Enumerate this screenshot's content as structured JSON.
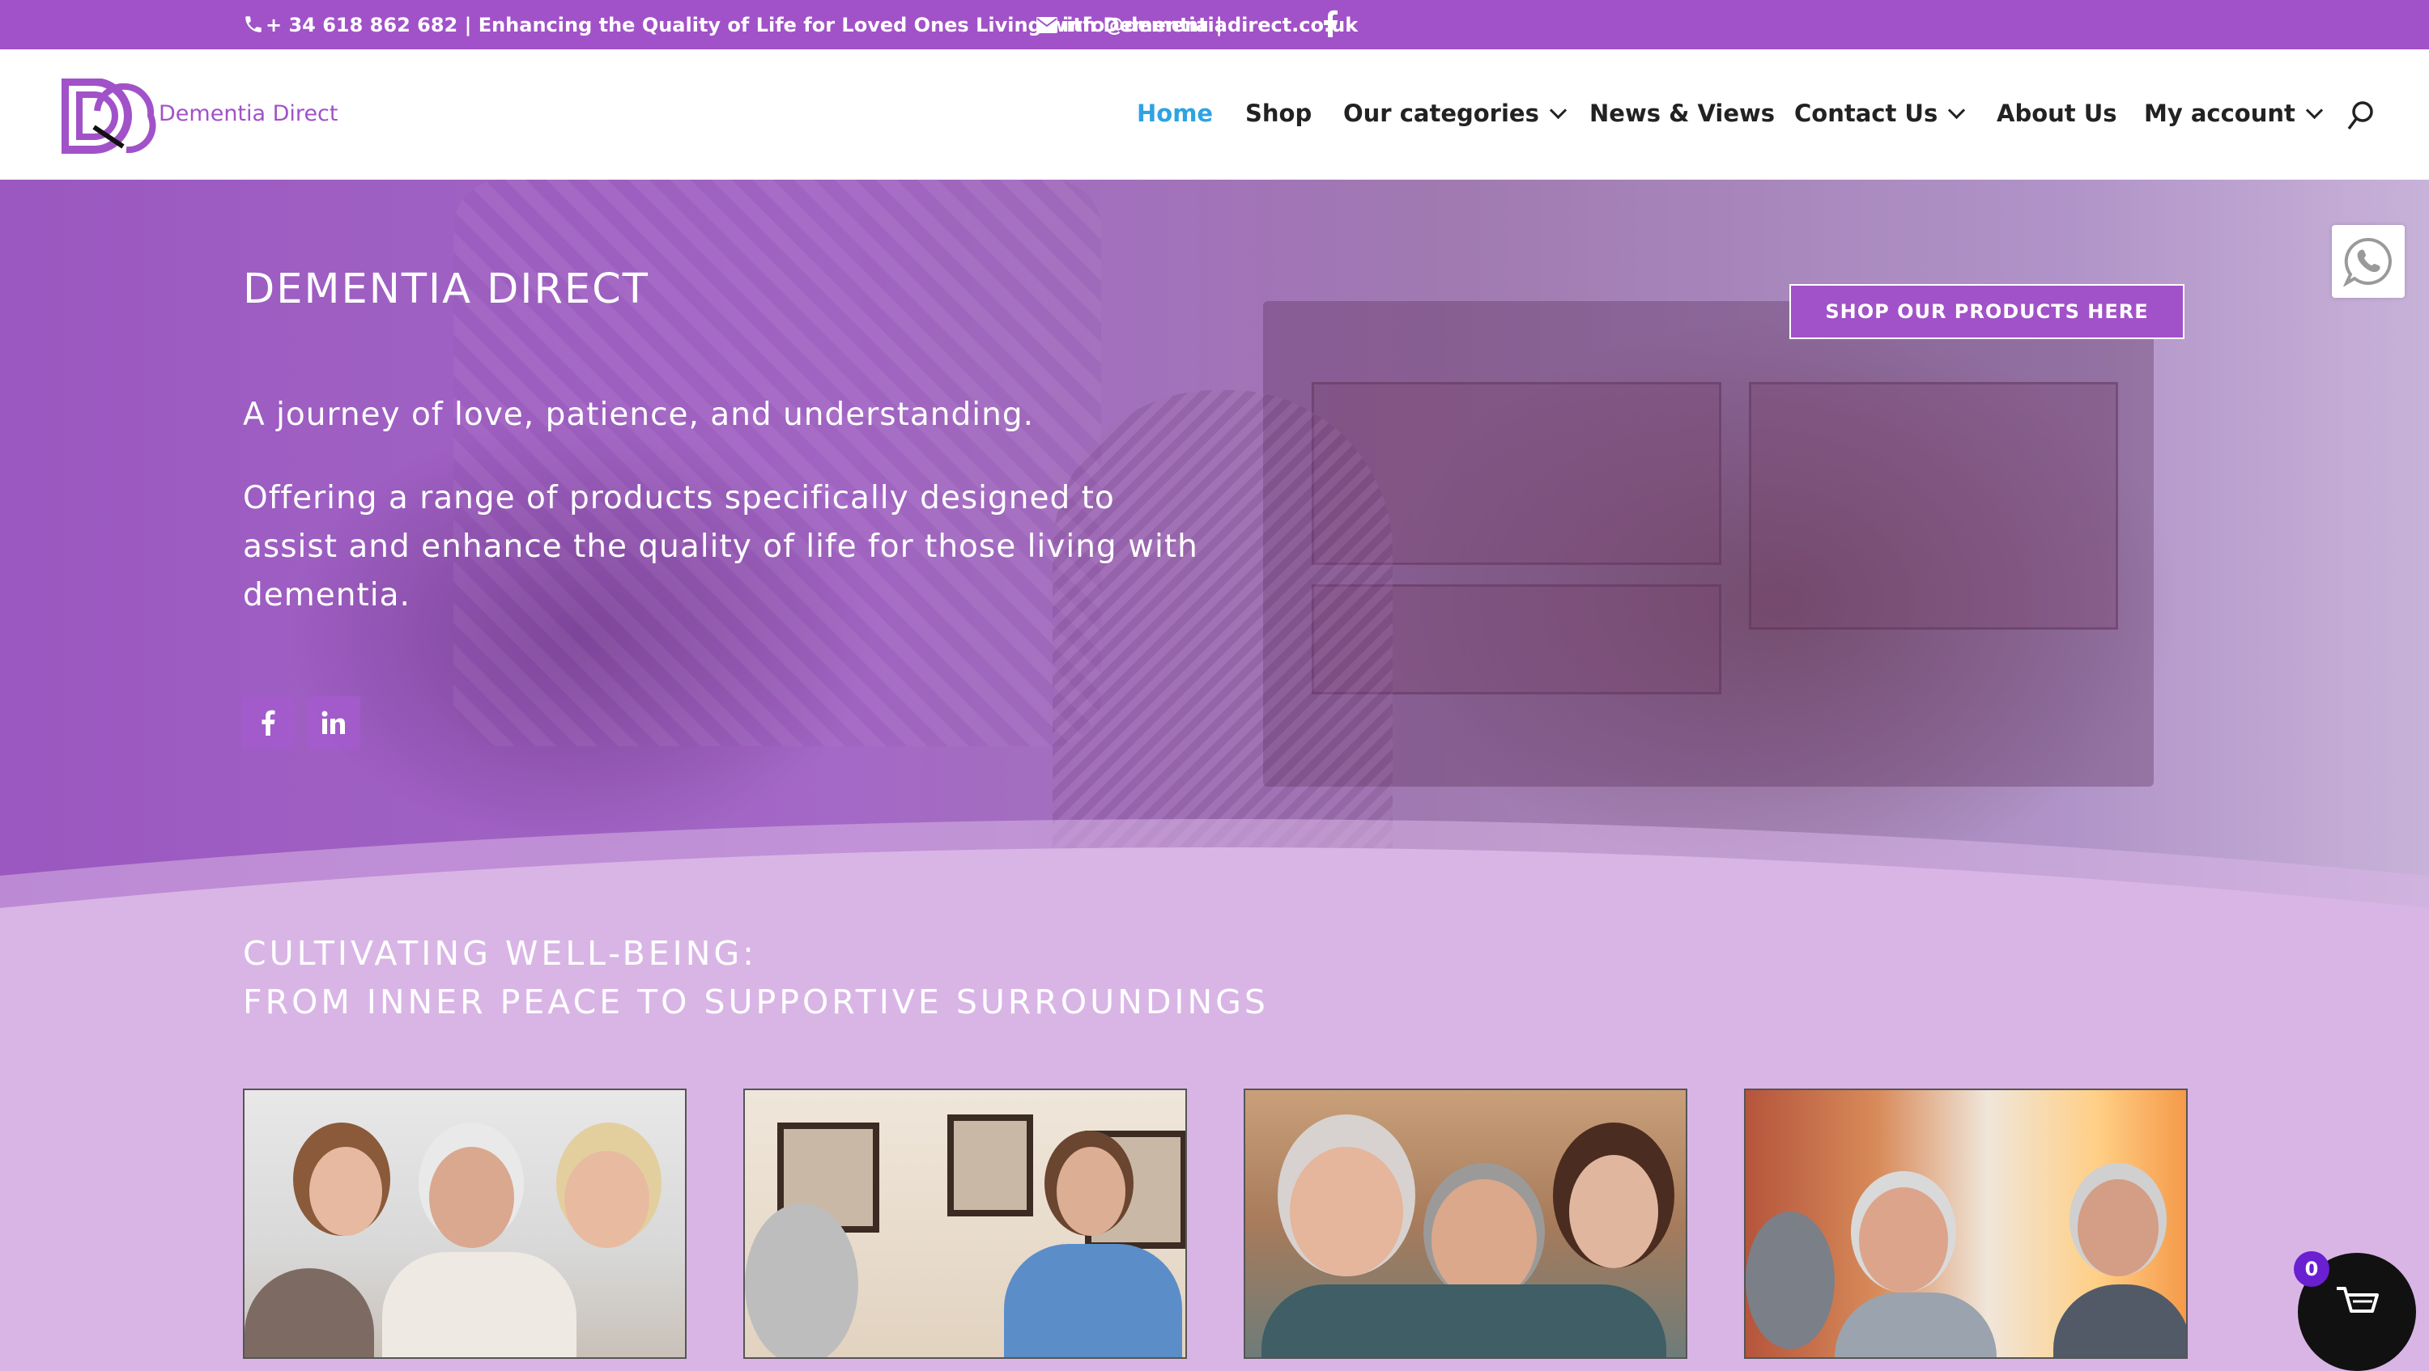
{
  "topbar": {
    "phone_text": "+ 34 618 862 682 | Enhancing the Quality of Life for Loved Ones Living with Dementia |",
    "email_text": "info@dementiadirect.co.uk",
    "icons": [
      "phone-icon",
      "mail-icon",
      "facebook-icon"
    ]
  },
  "header": {
    "logo_text": "Dementia Direct",
    "nav": [
      {
        "label": "Home",
        "active": true,
        "dropdown": false
      },
      {
        "label": "Shop",
        "active": false,
        "dropdown": false
      },
      {
        "label": "Our categories",
        "active": false,
        "dropdown": true
      },
      {
        "label": "News & Views",
        "active": false,
        "dropdown": false
      },
      {
        "label": "Contact Us",
        "active": false,
        "dropdown": true
      },
      {
        "label": "About Us",
        "active": false,
        "dropdown": false
      },
      {
        "label": "My account",
        "active": false,
        "dropdown": true
      }
    ]
  },
  "hero": {
    "title": "DEMENTIA DIRECT",
    "tagline": "A journey of love, patience, and understanding.",
    "description": "Offering a range of products specifically designed to assist and enhance the quality of life for those living with dementia.",
    "shop_button": "SHOP OUR PRODUCTS HERE",
    "social": [
      "facebook-icon",
      "linkedin-icon"
    ]
  },
  "section": {
    "title_line1": "CULTIVATING WELL-BEING:",
    "title_line2": "FROM INNER PEACE TO SUPPORTIVE SURROUNDINGS",
    "cards": [
      {
        "name": "family-with-elderly-man-image"
      },
      {
        "name": "nurse-consultation-image"
      },
      {
        "name": "family-group-image"
      },
      {
        "name": "elderly-men-at-table-image"
      }
    ]
  },
  "cart": {
    "count": "0"
  },
  "colors": {
    "brand_purple": "#a152c8",
    "nav_active": "#2ea3e3",
    "section_bg": "#d9b5e6",
    "cart_badge": "#6a1fd1"
  }
}
